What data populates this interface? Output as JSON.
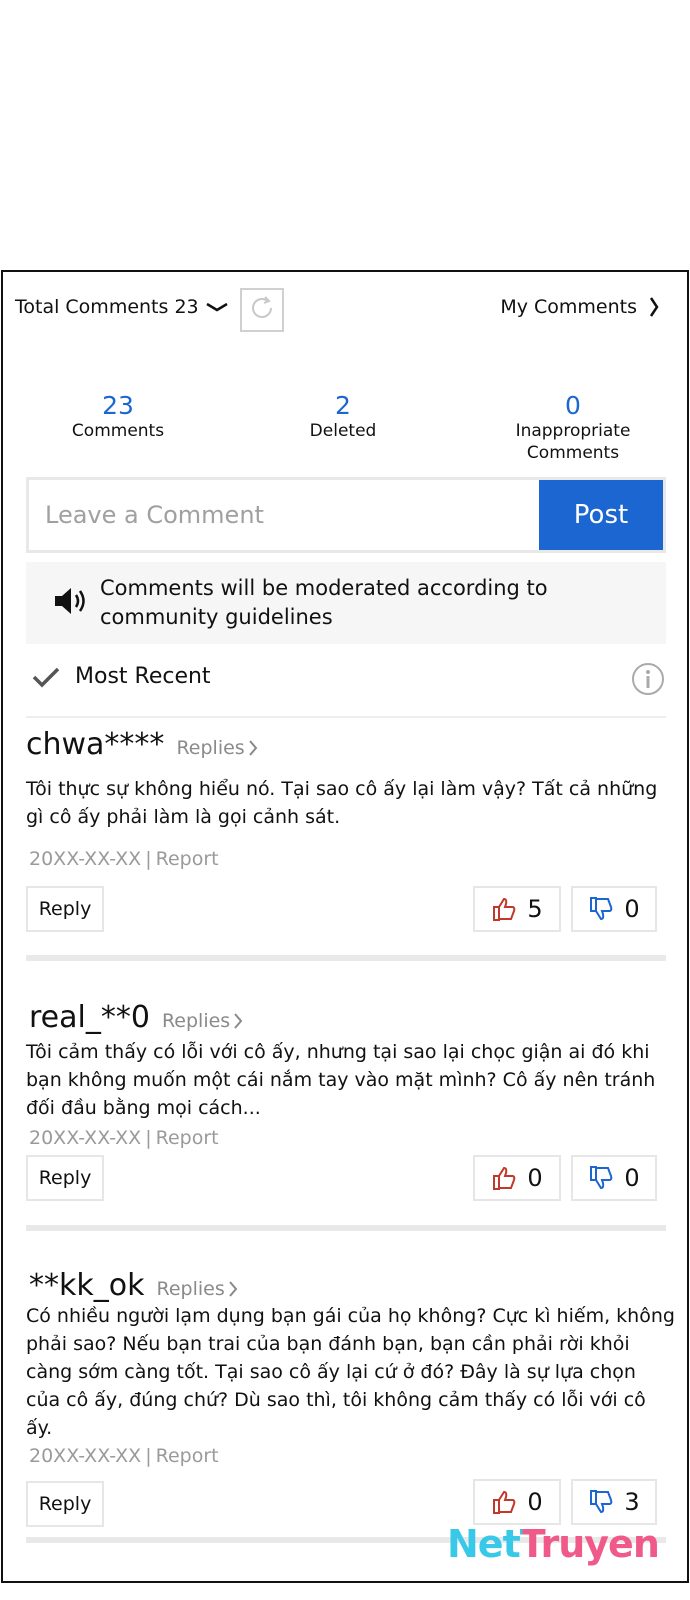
{
  "header": {
    "total_comments": "Total Comments 23",
    "my_comments": "My Comments"
  },
  "stats": [
    {
      "value": "23",
      "label": "Comments"
    },
    {
      "value": "2",
      "label": "Deleted"
    },
    {
      "value": "0",
      "label": "Inappropriate Comments"
    }
  ],
  "input": {
    "placeholder": "Leave a Comment",
    "post_label": "Post"
  },
  "notice": "Comments will be moderated according to community guidelines",
  "sort": {
    "label": "Most Recent"
  },
  "comments": [
    {
      "user": "chwa****",
      "replies": "Replies",
      "text": "Tôi thực sự không hiểu nó. Tại sao cô ấy lại làm vậy? Tất cả những gì cô ấy phải làm là gọi cảnh sát.",
      "date": "20XX-XX-XX",
      "report": "Report",
      "reply": "Reply",
      "likes": "5",
      "dislikes": "0"
    },
    {
      "user": "real_**0",
      "replies": "Replies",
      "text": "Tôi cảm thấy có lỗi với cô ấy, nhưng tại sao lại chọc giận ai đó khi bạn không muốn một cái nắm tay vào mặt mình? Cô ấy nên tránh đối đầu bằng mọi cách...",
      "date": "20XX-XX-XX",
      "report": "Report",
      "reply": "Reply",
      "likes": "0",
      "dislikes": "0"
    },
    {
      "user": "**kk_ok",
      "replies": "Replies",
      "text": "Có nhiều người lạm dụng bạn gái của họ không? Cực kì hiếm, không phải sao? Nếu bạn trai của bạn đánh bạn, bạn cần phải rời khỏi càng sớm càng tốt. Tại sao cô ấy lại cứ ở đó? Đây là sự lựa chọn của cô ấy, đúng chứ? Dù sao thì, tôi không cảm thấy có lỗi với cô ấy.",
      "date": "20XX-XX-XX",
      "report": "Report",
      "reply": "Reply",
      "likes": "0",
      "dislikes": "3"
    }
  ],
  "watermark": "NetTruyen",
  "colors": {
    "accent": "#1b66d1",
    "like": "#c0392b",
    "dislike": "#1b66d1"
  }
}
